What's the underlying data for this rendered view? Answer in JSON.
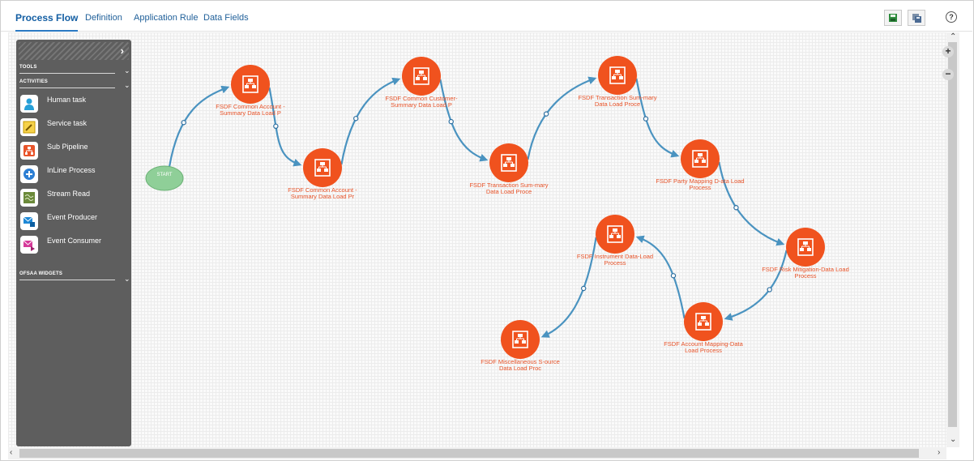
{
  "tabs": [
    {
      "label": "Process Flow",
      "active": true
    },
    {
      "label": "Definition",
      "active": false
    },
    {
      "label": "Application Rule",
      "active": false
    },
    {
      "label": "Data Fields",
      "active": false
    }
  ],
  "toolbar": {
    "save_icon": "save-icon",
    "save_as_icon": "save-as-icon",
    "help_glyph": "?"
  },
  "palette": {
    "sections": {
      "tools": "TOOLS",
      "activities": "ACTIVITIES",
      "widgets": "OFSAA WIDGETS"
    },
    "items": [
      {
        "label": "Human task",
        "icon": "human-task-icon",
        "color": "#27a0d8"
      },
      {
        "label": "Service task",
        "icon": "service-task-icon",
        "color": "#e6b800"
      },
      {
        "label": "Sub Pipeline",
        "icon": "sub-pipeline-icon",
        "color": "#e8542a"
      },
      {
        "label": "InLine Process",
        "icon": "inline-process-icon",
        "color": "#2d7fd4"
      },
      {
        "label": "Stream Read",
        "icon": "stream-read-icon",
        "color": "#6b8a3a"
      },
      {
        "label": "Event Producer",
        "icon": "event-producer-icon",
        "color": "#1e88d6"
      },
      {
        "label": "Event Consumer",
        "icon": "event-consumer-icon",
        "color": "#d63b9a"
      }
    ]
  },
  "flow": {
    "start_label": "START",
    "node_color": "#f0521e",
    "edge_color": "#4a93c0",
    "nodes": [
      {
        "id": "n1",
        "label": "FSDF Common Account - Summary Data Load P"
      },
      {
        "id": "n2",
        "label": "FSDF Common Account - Summary Data Load Pr"
      },
      {
        "id": "n3",
        "label": "FSDF Common Customer-Summary Data Load P"
      },
      {
        "id": "n4",
        "label": "FSDF Transaction Sum-mary Data Load Proce"
      },
      {
        "id": "n5",
        "label": "FSDF Transaction Sum-mary Data Load Proce"
      },
      {
        "id": "n6",
        "label": "FSDF Party Mapping D-ata Load Process"
      },
      {
        "id": "n7",
        "label": "FSDF Risk Mitigation-Data Load Process"
      },
      {
        "id": "n8",
        "label": "FSDF Account Mapping-Data Load Process"
      },
      {
        "id": "n9",
        "label": "FSDF Instrument Data-Load Process"
      },
      {
        "id": "n10",
        "label": "FSDF Miscellaneous S-ource Data Load Proc"
      }
    ]
  }
}
